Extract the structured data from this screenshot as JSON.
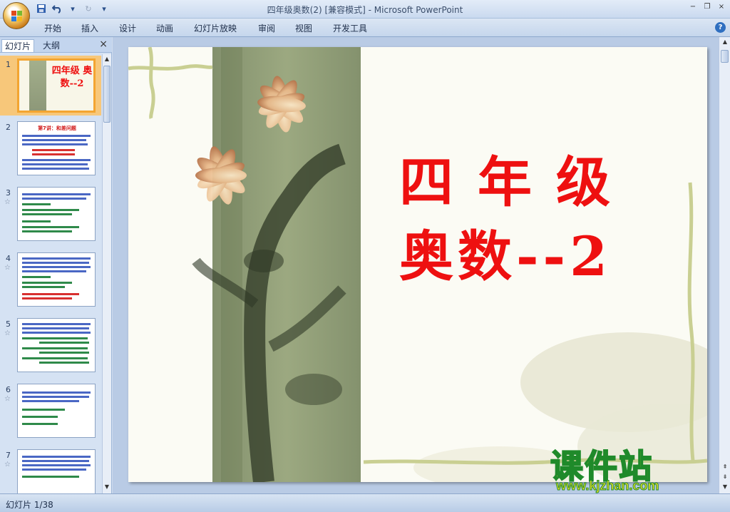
{
  "window": {
    "title": "四年级奥数(2) [兼容模式] - Microsoft PowerPoint"
  },
  "ribbon": {
    "tabs": [
      "开始",
      "插入",
      "设计",
      "动画",
      "幻灯片放映",
      "审阅",
      "视图",
      "开发工具"
    ]
  },
  "left_pane": {
    "tab_slides": "幻灯片",
    "tab_outline": "大纲",
    "close": "×",
    "thumbnails": [
      {
        "num": "1",
        "title": "四年级 奥数--2",
        "selected": true
      },
      {
        "num": "2",
        "title": "第7讲：和差问题"
      },
      {
        "num": "3",
        "title": ""
      },
      {
        "num": "4",
        "title": ""
      },
      {
        "num": "5",
        "title": ""
      },
      {
        "num": "6",
        "title": ""
      },
      {
        "num": "7",
        "title": ""
      }
    ]
  },
  "slide": {
    "title_line1": "四年级",
    "title_line2": "奥数--2"
  },
  "watermark": {
    "brand": "课件站",
    "url": "www.kjzhan.com"
  },
  "statusbar": {
    "slide_info": "幻灯片 1/38"
  }
}
